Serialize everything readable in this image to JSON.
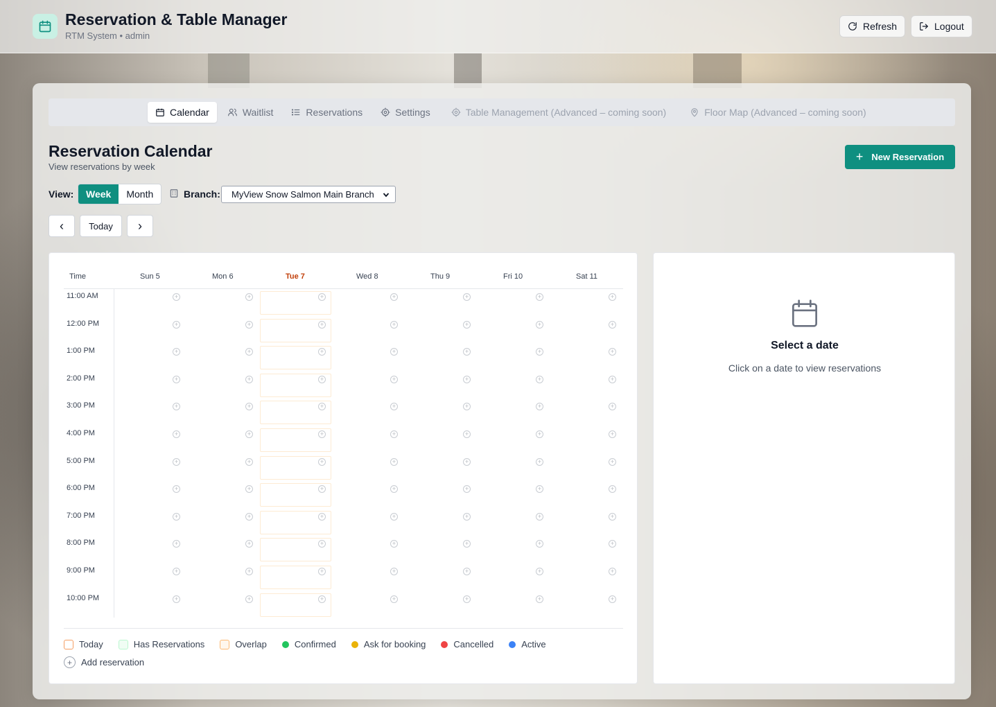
{
  "header": {
    "title": "Reservation & Table Manager",
    "subtitle": "RTM System • admin",
    "refresh_label": "Refresh",
    "logout_label": "Logout"
  },
  "tabs": [
    {
      "label": "Calendar",
      "icon": "calendar-icon",
      "state": "active"
    },
    {
      "label": "Waitlist",
      "icon": "users-icon",
      "state": "normal"
    },
    {
      "label": "Reservations",
      "icon": "list-icon",
      "state": "normal"
    },
    {
      "label": "Settings",
      "icon": "gear-icon",
      "state": "normal"
    },
    {
      "label": "Table Management (Advanced – coming soon)",
      "icon": "gear-icon",
      "state": "disabled"
    },
    {
      "label": "Floor Map (Advanced – coming soon)",
      "icon": "map-pin-icon",
      "state": "disabled"
    }
  ],
  "page": {
    "title": "Reservation Calendar",
    "subtitle": "View reservations by week",
    "new_button": "New Reservation"
  },
  "controls": {
    "view_label": "View:",
    "view_options": [
      "Week",
      "Month"
    ],
    "view_selected": "Week",
    "branch_label": "Branch:",
    "branch_value": "MyView Snow Salmon Main Branch",
    "prev_label": "‹",
    "today_label": "Today",
    "next_label": "›"
  },
  "calendar": {
    "time_header": "Time",
    "days": [
      "Sun 5",
      "Mon 6",
      "Tue 7",
      "Wed 8",
      "Thu 9",
      "Fri 10",
      "Sat 11"
    ],
    "today": "Tue 7",
    "times": [
      "11:00 AM",
      "12:00 PM",
      "1:00 PM",
      "2:00 PM",
      "3:00 PM",
      "4:00 PM",
      "5:00 PM",
      "6:00 PM",
      "7:00 PM",
      "8:00 PM",
      "9:00 PM",
      "10:00 PM"
    ],
    "today_color": "#c2410c"
  },
  "legend": {
    "items": [
      {
        "label": "Today",
        "kind": "square",
        "color": "#f59e63",
        "fill": "#ffffff"
      },
      {
        "label": "Has Reservations",
        "kind": "square",
        "color": "#bbf7d0",
        "fill": "#f0fdf4"
      },
      {
        "label": "Overlap",
        "kind": "square",
        "color": "#fdba74",
        "fill": "#fff7ed"
      },
      {
        "label": "Confirmed",
        "kind": "dot",
        "color": "#22c55e"
      },
      {
        "label": "Ask for booking",
        "kind": "dot",
        "color": "#eab308"
      },
      {
        "label": "Cancelled",
        "kind": "dot",
        "color": "#ef4444"
      },
      {
        "label": "Active",
        "kind": "dot",
        "color": "#3b82f6"
      }
    ],
    "add_label": "Add reservation"
  },
  "side": {
    "title": "Select a date",
    "subtitle": "Click on a date to view reservations"
  },
  "colors": {
    "accent": "#0f8f80"
  }
}
